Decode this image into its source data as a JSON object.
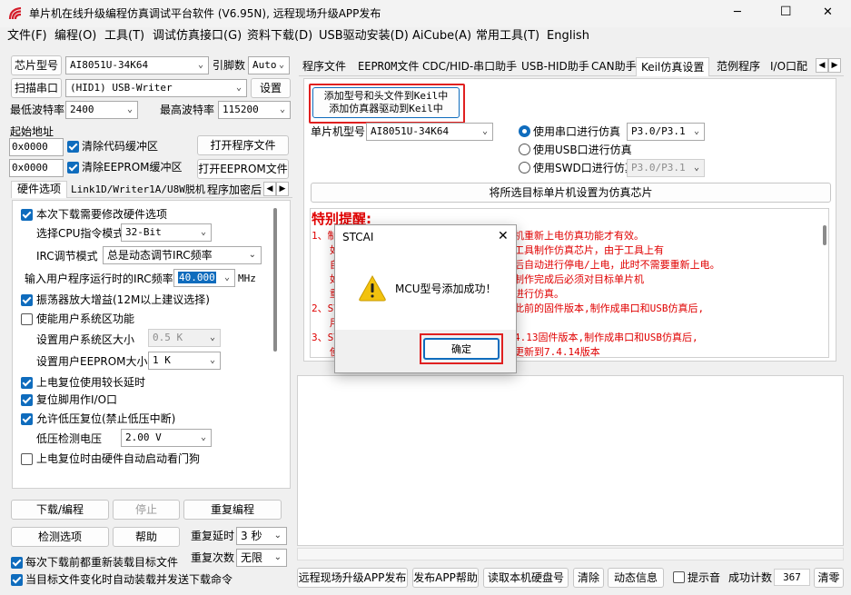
{
  "window": {
    "title": "单片机在线升级编程仿真调试平台软件 (V6.95N), 远程现场升级APP发布",
    "minimize": "─",
    "maximize": "☐",
    "close": "✕"
  },
  "menu": [
    "文件(F)",
    "编程(O)",
    "工具(T)",
    "调试仿真接口(G)",
    "资料下载(D)",
    "USB驱动安装(D)",
    "AiCube(A)",
    "常用工具(T)",
    "English"
  ],
  "left": {
    "chip_label": "芯片型号",
    "chip_value": "AI8051U-34K64",
    "pins_label": "引脚数",
    "pins_value": "Auto",
    "scan_button": "扫描串口",
    "port_value": "(HID1) USB-Writer",
    "settings_button": "设置",
    "min_baud_label": "最低波特率",
    "min_baud_value": "2400",
    "max_baud_label": "最高波特率",
    "max_baud_value": "115200",
    "start_addr_label": "起始地址",
    "code_addr": "0x0000",
    "clear_code": "清除代码缓冲区",
    "open_program": "打开程序文件",
    "eeprom_addr": "0x0000",
    "clear_eeprom": "清除EEPROM缓冲区",
    "open_eeprom": "打开EEPROM文件",
    "tabs": [
      "硬件选项",
      "Link1D/Writer1A/U8W脱机",
      "程序加密后"
    ],
    "hw": {
      "modify_hw": "本次下载需要修改硬件选项",
      "cpu_mode_label": "选择CPU指令模式",
      "cpu_mode_value": "32-Bit",
      "irc_mode_label": "IRC调节模式",
      "irc_mode_value": "总是动态调节IRC频率",
      "irc_freq_label": "输入用户程序运行时的IRC频率",
      "irc_freq_value": "40.000",
      "irc_unit": "MHz",
      "osc_gain": "振荡器放大增益(12M以上建议选择)",
      "user_sys": "使能用户系统区功能",
      "user_sys_size_label": "设置用户系统区大小",
      "user_sys_size_value": "0.5 K",
      "user_eeprom_label": "设置用户EEPROM大小",
      "user_eeprom_value": "1   K",
      "por_delay": "上电复位使用较长延时",
      "reset_io": "复位脚用作I/O口",
      "lvr": "允许低压复位(禁止低压中断)",
      "lvd_label": "低压检测电压",
      "lvd_value": "2.00 V",
      "wdt": "上电复位时由硬件自动启动看门狗"
    },
    "download_button": "下载/编程",
    "stop_button": "停止",
    "reprogram_button": "重复编程",
    "detect_button": "检测选项",
    "help_button": "帮助",
    "repeat_delay_label": "重复延时",
    "repeat_delay_value": "3 秒",
    "repeat_count_label": "重复次数",
    "repeat_count_value": "无限",
    "reload_each": "每次下载前都重新装载目标文件",
    "auto_send": "当目标文件变化时自动装载并发送下载命令"
  },
  "right": {
    "tabs": [
      "程序文件",
      "EEPROM文件",
      "CDC/HID-串口助手",
      "USB-HID助手",
      "CAN助手",
      "Keil仿真设置",
      "范例程序",
      "I/O口配"
    ],
    "keil_button_line1": "添加型号和头文件到Keil中",
    "keil_button_line2": "添加仿真器驱动到Keil中",
    "mcu_label": "单片机型号",
    "mcu_value": "AI8051U-34K64",
    "serial_sim": "使用串口进行仿真",
    "serial_pins": "P3.0/P3.1",
    "usb_sim": "使用USB口进行仿真",
    "swd_sim": "使用SWD口进行仿真",
    "swd_pins": "P3.0/P3.1",
    "set_sim_chip": "将所选目标单片机设置为仿真芯片",
    "notice_title": "特别提醒:",
    "notice_lines": [
      "1、制",
      "   如",
      "   自",
      "   如",
      "   重",
      "2、ST",
      "   用",
      "3、ST",
      "   使"
    ],
    "notice_right": [
      "机重新上电仿真功能才有效。",
      "工具制作仿真芯片，由于工具上有",
      "后自动进行停电/上电，此时不需要重新上电。",
      "制作完成后必须对目标单片机",
      "进行仿真。",
      "此前的固件版本,制作成串口和USB仿真后,",
      "",
      "4.13固件版本,制作成串口和USB仿真后,",
      "更新到7.4.14版本"
    ]
  },
  "bottom": {
    "remote_publish": "远程现场升级APP发布",
    "publish_help": "发布APP帮助",
    "read_disk": "读取本机硬盘号",
    "clear": "清除",
    "anim": "动态信息",
    "beep": "提示音",
    "success_label": "成功计数",
    "success_count": "367",
    "clear_count": "清零"
  },
  "dialog": {
    "title": "STCAI",
    "message": "MCU型号添加成功！",
    "ok": "确定"
  },
  "colors": {
    "accent": "#0f6cbd",
    "red_text": "#e00000",
    "highlight_box": "#e02020"
  }
}
